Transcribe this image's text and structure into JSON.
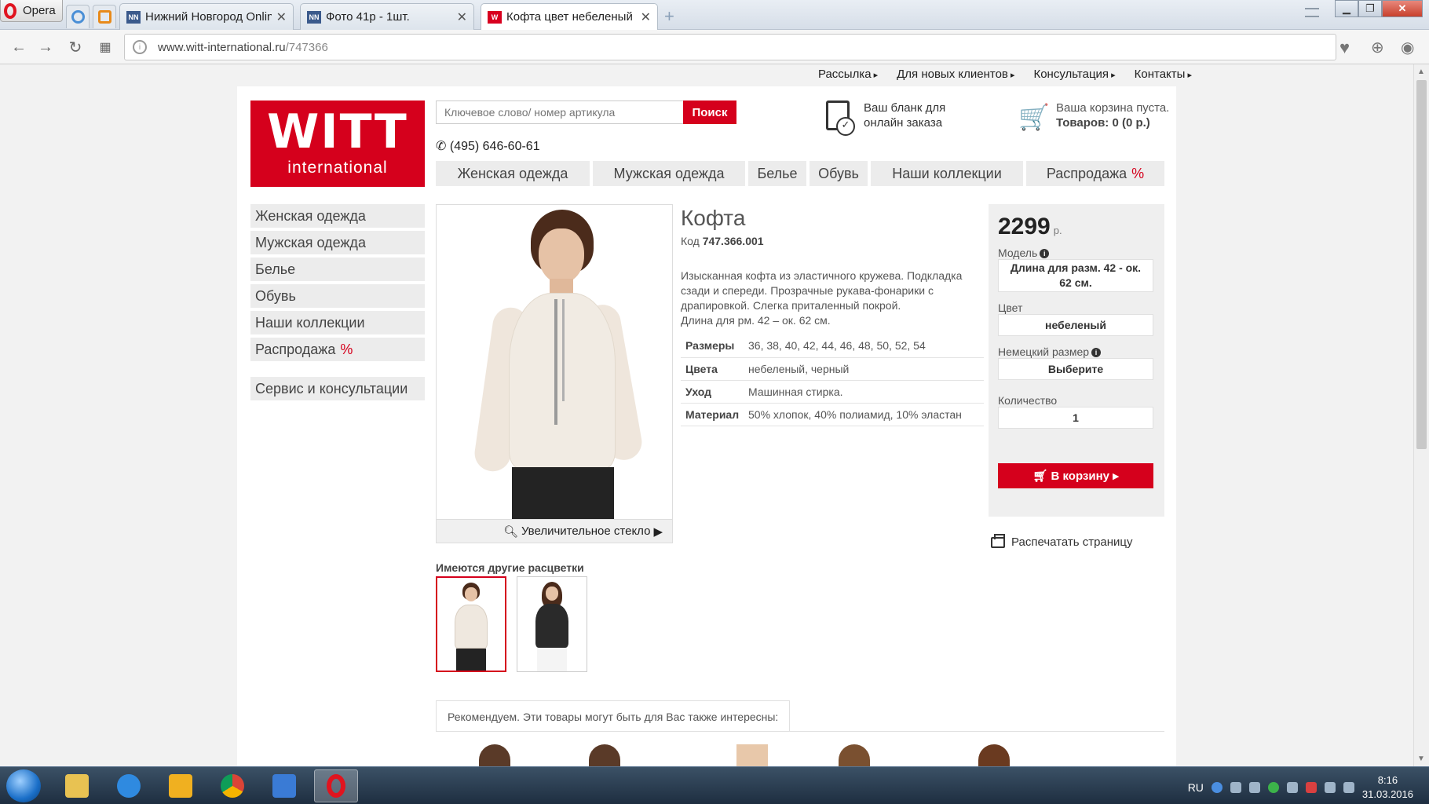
{
  "browser": {
    "opera_label": "Opera",
    "tabs": [
      {
        "favicon": "NN",
        "title": "Нижний Новгород Online",
        "active": false
      },
      {
        "favicon": "NN",
        "title": "Фото 41р - 1шт.",
        "active": false
      },
      {
        "favicon": "W",
        "title": "Кофта цвет небеленый в",
        "active": true
      }
    ],
    "url_domain": "www.witt-international.ru",
    "url_path": "/747366"
  },
  "site": {
    "top_links": [
      "Рассылка",
      "Для новых клиентов",
      "Консультация",
      "Контакты"
    ],
    "logo_big": "WITT",
    "logo_small": "international",
    "search_placeholder": "Ключевое слово/ номер артикула",
    "search_button": "Поиск",
    "phone": "(495) 646-60-61",
    "order_form_line1": "Ваш бланк для",
    "order_form_line2": "онлайн заказа",
    "cart_line1": "Ваша корзина пуста.",
    "cart_line2": "Товаров: 0 (0 р.)",
    "main_nav": [
      "Женская одежда",
      "Мужская одежда",
      "Белье",
      "Обувь",
      "Наши коллекции",
      "Распродажа"
    ],
    "sale_percent": "%",
    "side_nav": [
      "Женская одежда",
      "Мужская одежда",
      "Белье",
      "Обувь",
      "Наши коллекции",
      "Распродажа"
    ],
    "side_service": "Сервис и консультации"
  },
  "product": {
    "title": "Кофта",
    "code_label": "Код",
    "code": "747.366.001",
    "description": "Изысканная кофта из эластичного кружева. Подкладка сзади и спереди. Прозрачные рукава-фонарики с драпировкой. Слегка приталенный покрой.",
    "length_note": "Длина для рм. 42 – ок. 62 см.",
    "specs": [
      {
        "label": "Размеры",
        "value": "36, 38, 40, 42, 44, 46, 48, 50, 52, 54"
      },
      {
        "label": "Цвета",
        "value": "небеленый, черный"
      },
      {
        "label": "Уход",
        "value": "Машинная стирка."
      },
      {
        "label": "Материал",
        "value": "50% хлопок, 40% полиамид, 10% эластан"
      }
    ],
    "zoom_label": "Увеличительное стекло",
    "variants_label": "Имеются другие расцветки"
  },
  "buybox": {
    "price": "2299",
    "currency": "р.",
    "model_label": "Модель",
    "model_value": "Длина для разм. 42 - ок. 62 см.",
    "color_label": "Цвет",
    "color_value": "небеленый",
    "size_label": "Немецкий размер",
    "size_value": "Выберите",
    "qty_label": "Количество",
    "qty_value": "1",
    "cart_button": "В корзину"
  },
  "print_label": "Распечатать страницу",
  "recommend_label": "Рекомендуем. Эти товары могут быть для Вас также интересны:",
  "taskbar": {
    "lang": "RU",
    "time": "8:16",
    "date": "31.03.2016"
  },
  "colors": {
    "brand_red": "#d5001c"
  }
}
